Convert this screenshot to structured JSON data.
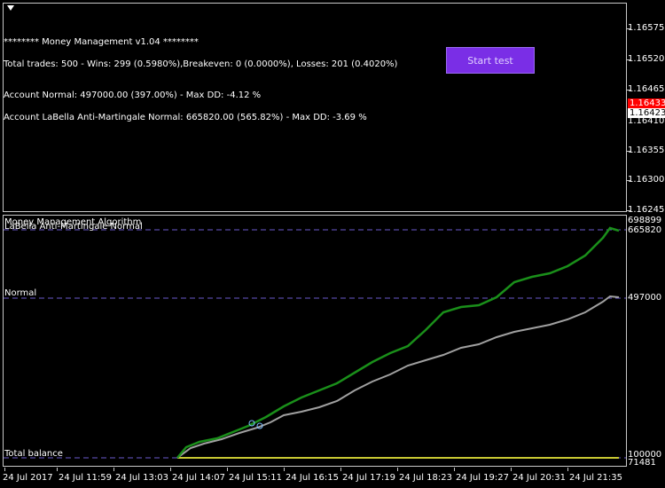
{
  "main_pane": {
    "title": "********   Money Management  v1.04  ********",
    "summary": "Total trades: 500 - Wins: 299 (0.5980%),Breakeven: 0 (0.0000%), Losses: 201 (0.4020%)",
    "account_normal": "Account Normal: 497000.00 (397.00%) - Max DD: -4.12 %",
    "account_labella": "Account LaBella Anti-Martingale Normal: 665820.00 (565.82%) - Max DD: -3.69 %",
    "start_button": "Start test"
  },
  "price_axis": {
    "labels": [
      "1.16575",
      "1.16520",
      "1.16465",
      "1.16410",
      "1.16355",
      "1.16300",
      "1.16245"
    ],
    "bid_tag": "1.16433",
    "current_tag": "1.16423",
    "bid_color": "#ff0000"
  },
  "indicator": {
    "title": "Money Management Algorithm",
    "labella_label": "LaBella Anti-Martingale Normal",
    "normal_label": "Normal",
    "total_balance_label": "Total balance",
    "axis_labels": {
      "top": "698899",
      "labella": "665820",
      "normal": "497000",
      "base": "100000",
      "bottom": "71481"
    },
    "colors": {
      "labella": "#1aa51a",
      "normal": "#a0a0a0",
      "dash": "#6a5acd",
      "base": "#c8c832"
    }
  },
  "time_axis": [
    "24 Jul 2017",
    "24 Jul 11:59",
    "24 Jul 13:03",
    "24 Jul 14:07",
    "24 Jul 15:11",
    "24 Jul 16:15",
    "24 Jul 17:19",
    "24 Jul 18:23",
    "24 Jul 19:27",
    "24 Jul 20:31",
    "24 Jul 21:35"
  ]
}
